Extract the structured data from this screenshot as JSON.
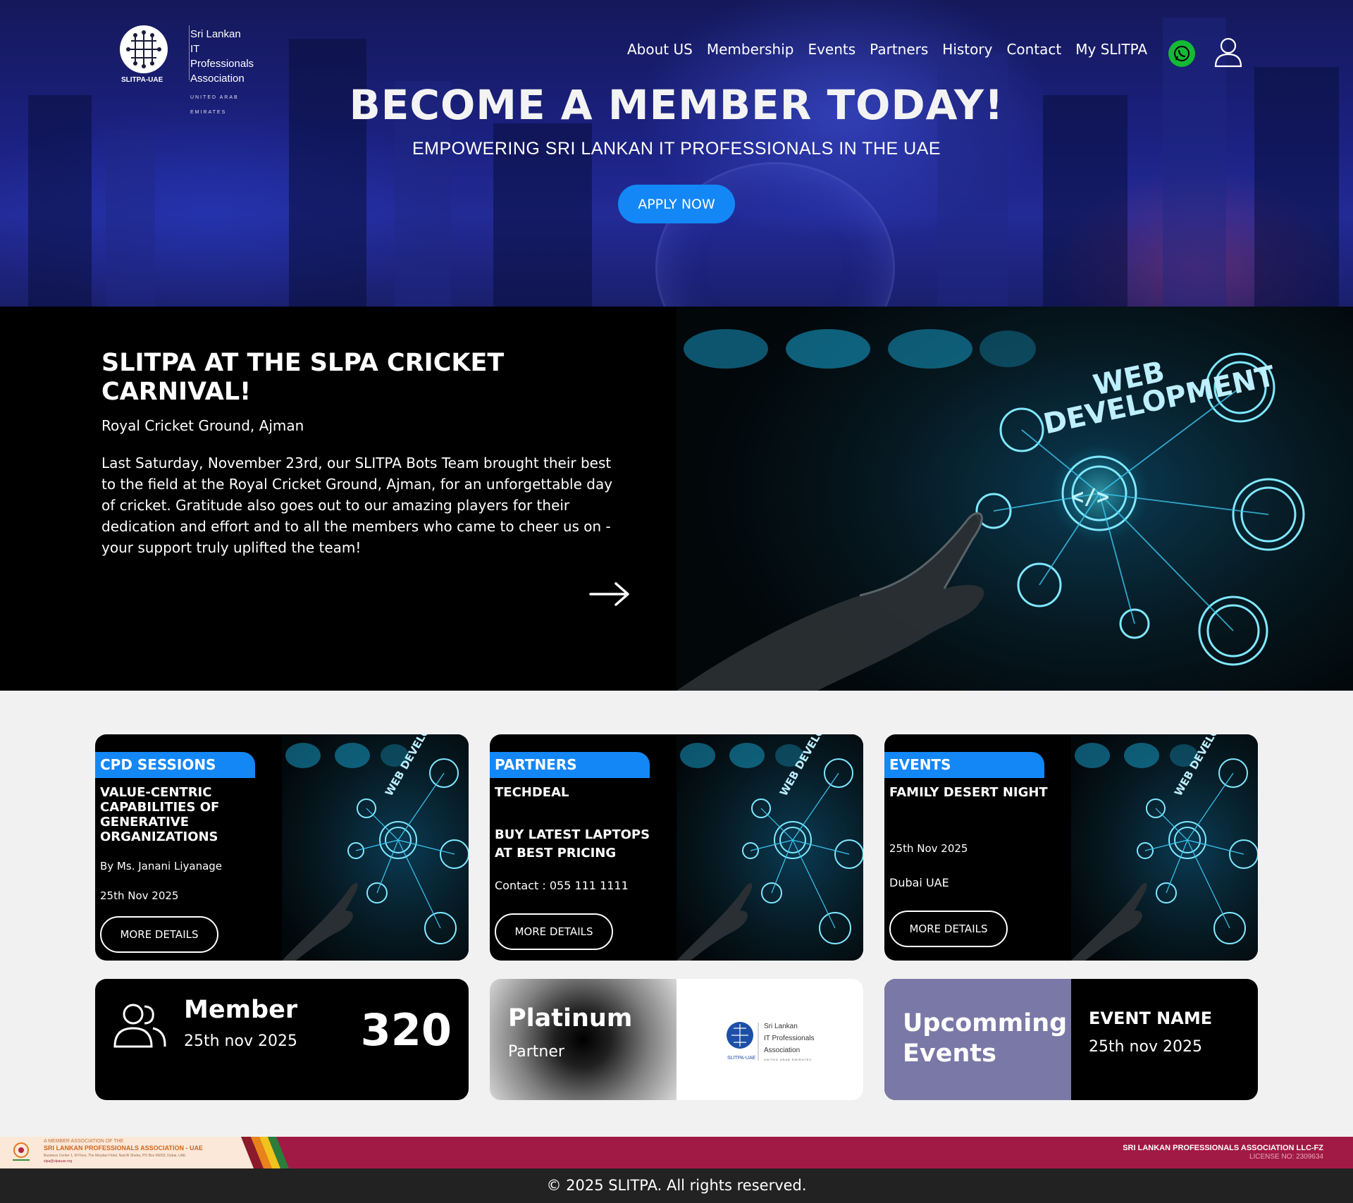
{
  "header": {
    "logo_abbr": "SLITPA-UAE",
    "logo_lines": [
      "Sri Lankan",
      "IT Professionals",
      "Association"
    ],
    "logo_sub": "UNITED ARAB EMIRATES",
    "nav": [
      "About US",
      "Membership",
      "Events",
      "Partners",
      "History",
      "Contact",
      "My SLITPA"
    ],
    "whatsapp_icon": "whatsapp-icon",
    "user_icon": "user-icon"
  },
  "hero": {
    "title": "BECOME A MEMBER TODAY!",
    "subtitle": "EMPOWERING SRI LANKAN IT PROFESSIONALS IN THE UAE",
    "cta": "APPLY NOW"
  },
  "feature": {
    "title": "SLITPA AT THE SLPA CRICKET CARNIVAL!",
    "location": "Royal Cricket Ground, Ajman",
    "body": "Last Saturday, November 23rd, our SLITPA Bots Team brought their best to the field at the Royal Cricket Ground, Ajman, for an unforgettable day of cricket. Gratitude also goes out to our amazing players for their dedication and effort and to all the members who came to cheer us on - your support truly uplifted the team!",
    "image_text": [
      "WEB",
      "DEVELOPMENT"
    ]
  },
  "cards": [
    {
      "tag": "CPD SESSIONS",
      "title": "VALUE-CENTRIC CAPABILITIES OF GENERATIVE ORGANIZATIONS",
      "line1": "By Ms. Janani Liyanage",
      "line2": "25th Nov 2025",
      "button": "MORE DETAILS"
    },
    {
      "tag": "PARTNERS",
      "title": "TECHDEAL",
      "title2": "BUY LATEST LAPTOPS AT BEST PRICING",
      "line1": "Contact : 055 111 1111",
      "button": "MORE DETAILS"
    },
    {
      "tag": "EVENTS",
      "title": "FAMILY DESERT NIGHT",
      "line1": "25th Nov 2025",
      "line2": "Dubai UAE",
      "button": "MORE DETAILS"
    }
  ],
  "stats": {
    "member": {
      "label": "Member",
      "date": "25th nov 2025",
      "count": "320"
    },
    "partner": {
      "label": "Platinum",
      "sub": "Partner"
    },
    "upcoming": {
      "label": "Upcomming Events",
      "event_name": "EVENT NAME",
      "event_date": "25th nov 2025"
    }
  },
  "footer": {
    "member_of": "A MEMBER ASSOCIATION OF THE",
    "assoc_name": "SRI LANKAN PROFESSIONALS ASSOCIATION - UAE",
    "address": "Business Center 1, M Floor, The Meydan Hotel, Nad Al Sheba, PO Box 66003, Dubai, UAE",
    "email": "slpa@slpauae.org",
    "company": "SRI LANKAN PROFESSIONALS ASSOCIATION LLC-FZ",
    "license": "LICENSE NO: 2309634",
    "copyright": "© 2025 SLITPA. All rights reserved."
  },
  "colors": {
    "accent": "#1487f7",
    "whatsapp": "#14b934",
    "banner": "#a11a45",
    "upcoming_panel": "#7a78a6"
  }
}
